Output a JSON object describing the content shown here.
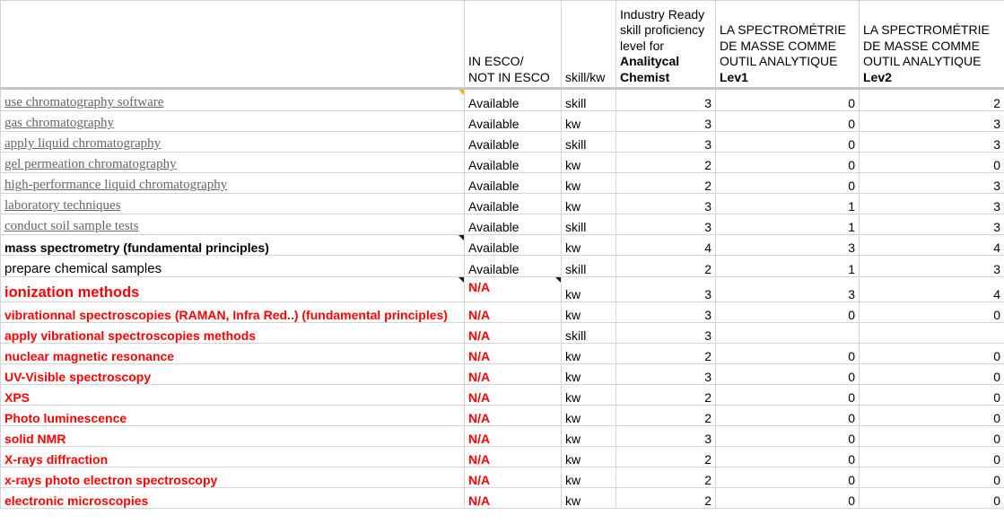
{
  "header": {
    "c1_l1": "IN ESCO/",
    "c1_l2": "NOT IN ESCO",
    "c2": "skill/kw",
    "c3_pre": "Industry Ready skill proficiency level for ",
    "c3_bold": "Analitycal Chemist",
    "c4_pre": "LA SPECTROMÉTRIE DE MASSE COMME OUTIL ANALYTIQUE ",
    "c4_bold": "Lev1",
    "c5_pre": "LA SPECTROMÉTRIE DE MASSE COMME OUTIL ANALYTIQUE ",
    "c5_bold": "Lev2"
  },
  "rows": [
    {
      "name": "use chromatography software",
      "esco": "Available",
      "type": "skill",
      "level": "3",
      "lev1": "0",
      "lev2": "2"
    },
    {
      "name": "gas chromatography",
      "esco": "Available",
      "type": "kw",
      "level": "3",
      "lev1": "0",
      "lev2": "3"
    },
    {
      "name": "apply liquid chromatography",
      "esco": "Available",
      "type": "skill",
      "level": "3",
      "lev1": "0",
      "lev2": "3"
    },
    {
      "name": "gel permeation chromatography",
      "esco": "Available",
      "type": "kw",
      "level": "2",
      "lev1": "0",
      "lev2": "0"
    },
    {
      "name": "high-performance liquid chromatography",
      "esco": "Available",
      "type": "kw",
      "level": "2",
      "lev1": "0",
      "lev2": "3"
    },
    {
      "name": "laboratory techniques",
      "esco": "Available",
      "type": "kw",
      "level": "3",
      "lev1": "1",
      "lev2": "3"
    },
    {
      "name": "conduct soil sample tests",
      "esco": "Available",
      "type": "skill",
      "level": "3",
      "lev1": "1",
      "lev2": "3"
    },
    {
      "name": "mass spectrometry (fundamental principles)",
      "esco": "Available",
      "type": "kw",
      "level": "4",
      "lev1": "3",
      "lev2": "4"
    },
    {
      "name": "prepare chemical samples",
      "esco": "Available",
      "type": "skill",
      "level": "2",
      "lev1": "1",
      "lev2": "3"
    },
    {
      "name": "ionization methods",
      "esco": "N/A",
      "type": "kw",
      "level": "3",
      "lev1": "3",
      "lev2": "4"
    },
    {
      "name": "vibrationnal spectroscopies (RAMAN, Infra Red..) (fundamental principles)",
      "esco": "N/A",
      "type": "kw",
      "level": "3",
      "lev1": "0",
      "lev2": "0"
    },
    {
      "name": "apply vibrational spectroscopies methods",
      "esco": "N/A",
      "type": "skill",
      "level": "3",
      "lev1": "",
      "lev2": ""
    },
    {
      "name": "nuclear magnetic resonance",
      "esco": "N/A",
      "type": "kw",
      "level": "2",
      "lev1": "0",
      "lev2": "0"
    },
    {
      "name": "UV-Visible spectroscopy",
      "esco": "N/A",
      "type": "kw",
      "level": "3",
      "lev1": "0",
      "lev2": "0"
    },
    {
      "name": "XPS",
      "esco": "N/A",
      "type": "kw",
      "level": "2",
      "lev1": "0",
      "lev2": "0"
    },
    {
      "name": "Photo luminescence",
      "esco": "N/A",
      "type": "kw",
      "level": "2",
      "lev1": "0",
      "lev2": "0"
    },
    {
      "name": "solid NMR",
      "esco": "N/A",
      "type": "kw",
      "level": "3",
      "lev1": "0",
      "lev2": "0"
    },
    {
      "name": "X-rays diffraction",
      "esco": "N/A",
      "type": "kw",
      "level": "2",
      "lev1": "0",
      "lev2": "0"
    },
    {
      "name": "x-rays photo electron spectroscopy",
      "esco": "N/A",
      "type": "kw",
      "level": "2",
      "lev1": "0",
      "lev2": "0"
    },
    {
      "name": "electronic microscopies",
      "esco": "N/A",
      "type": "kw",
      "level": "2",
      "lev1": "0",
      "lev2": "0"
    }
  ]
}
